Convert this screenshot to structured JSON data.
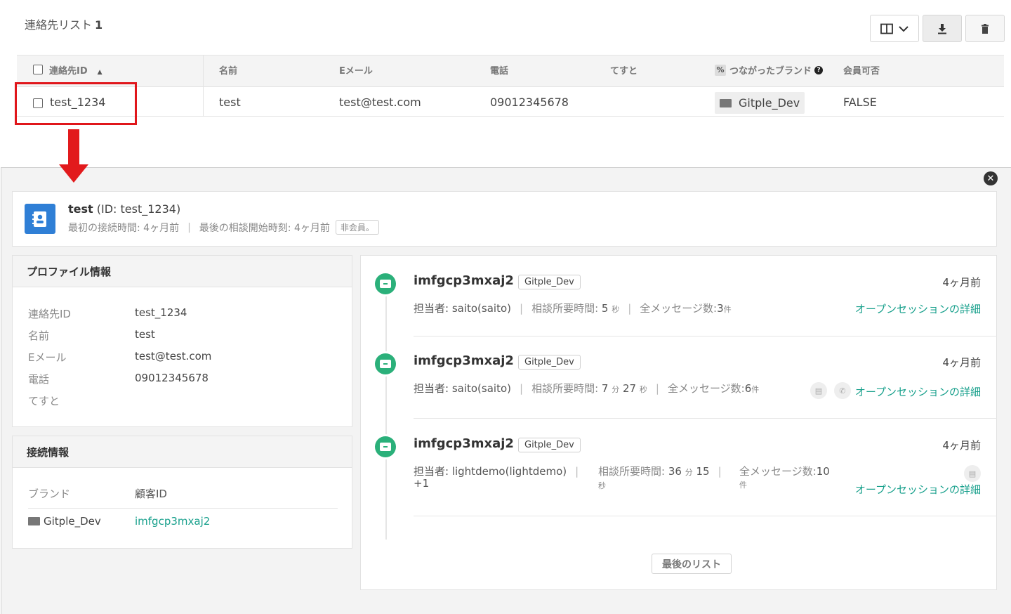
{
  "list": {
    "title": "連絡先リスト",
    "count": "1",
    "columns": [
      "連絡先ID",
      "名前",
      "Eメール",
      "電話",
      "てすと",
      "つながったブランド",
      "会員可否"
    ],
    "row": {
      "contact_id": "test_1234",
      "name": "test",
      "email": "test@test.com",
      "phone": "09012345678",
      "test": "",
      "brand": "Gitple_Dev",
      "member": "FALSE"
    }
  },
  "detail": {
    "close_icon": "close-icon",
    "summary": {
      "name": "test",
      "id_text": "(ID: test_1234)",
      "first_connect": "最初の接続時間: 4ヶ月前",
      "last_consult": "最後の相談開始時刻: 4ヶ月前",
      "member_tag": "非会員。"
    },
    "profile": {
      "header": "プロファイル情報",
      "labels": [
        "連絡先ID",
        "名前",
        "Eメール",
        "電話",
        "てすと"
      ],
      "values": [
        "test_1234",
        "test",
        "test@test.com",
        "09012345678",
        ""
      ]
    },
    "connection": {
      "header": "接続情報",
      "label_brand": "ブランド",
      "label_customer": "顧客ID",
      "brand": "Gitple_Dev",
      "customer_id": "imfgcp3mxaj2"
    },
    "sessions": [
      {
        "title": "imfgcp3mxaj2",
        "brand": "Gitple_Dev",
        "time": "4ヶ月前",
        "agent": "担当者: saito(saito)",
        "duration_label": "相談所要時間:",
        "duration_a": "5",
        "duration_a_unit": "秒",
        "duration_b": "",
        "duration_b_unit": "",
        "messages_label": "全メッセージ数:",
        "messages": "3",
        "messages_unit": "件",
        "link": "オープンセッションの詳細"
      },
      {
        "title": "imfgcp3mxaj2",
        "brand": "Gitple_Dev",
        "time": "4ヶ月前",
        "agent": "担当者: saito(saito)",
        "duration_label": "相談所要時間:",
        "duration_a": "7",
        "duration_a_unit": "分",
        "duration_b": "27",
        "duration_b_unit": "秒",
        "messages_label": "全メッセージ数:",
        "messages": "6",
        "messages_unit": "件",
        "link": "オープンセッションの詳細"
      },
      {
        "title": "imfgcp3mxaj2",
        "brand": "Gitple_Dev",
        "time": "4ヶ月前",
        "agent": "担当者: lightdemo(lightdemo)",
        "agent_extra": "+1",
        "duration_label": "相談所要時間:",
        "duration_a": "36",
        "duration_a_unit": "分",
        "duration_b": "15",
        "duration_b_unit": "秒",
        "messages_label": "全メッセージ数:",
        "messages": "10",
        "messages_unit": "件",
        "link": "オープンセッションの詳細"
      }
    ],
    "last_list_button": "最後のリスト"
  },
  "colors": {
    "accent_link": "#18a08c",
    "session_icon": "#2bb07a",
    "avatar": "#2f7fd6",
    "highlight": "#e0161b"
  }
}
